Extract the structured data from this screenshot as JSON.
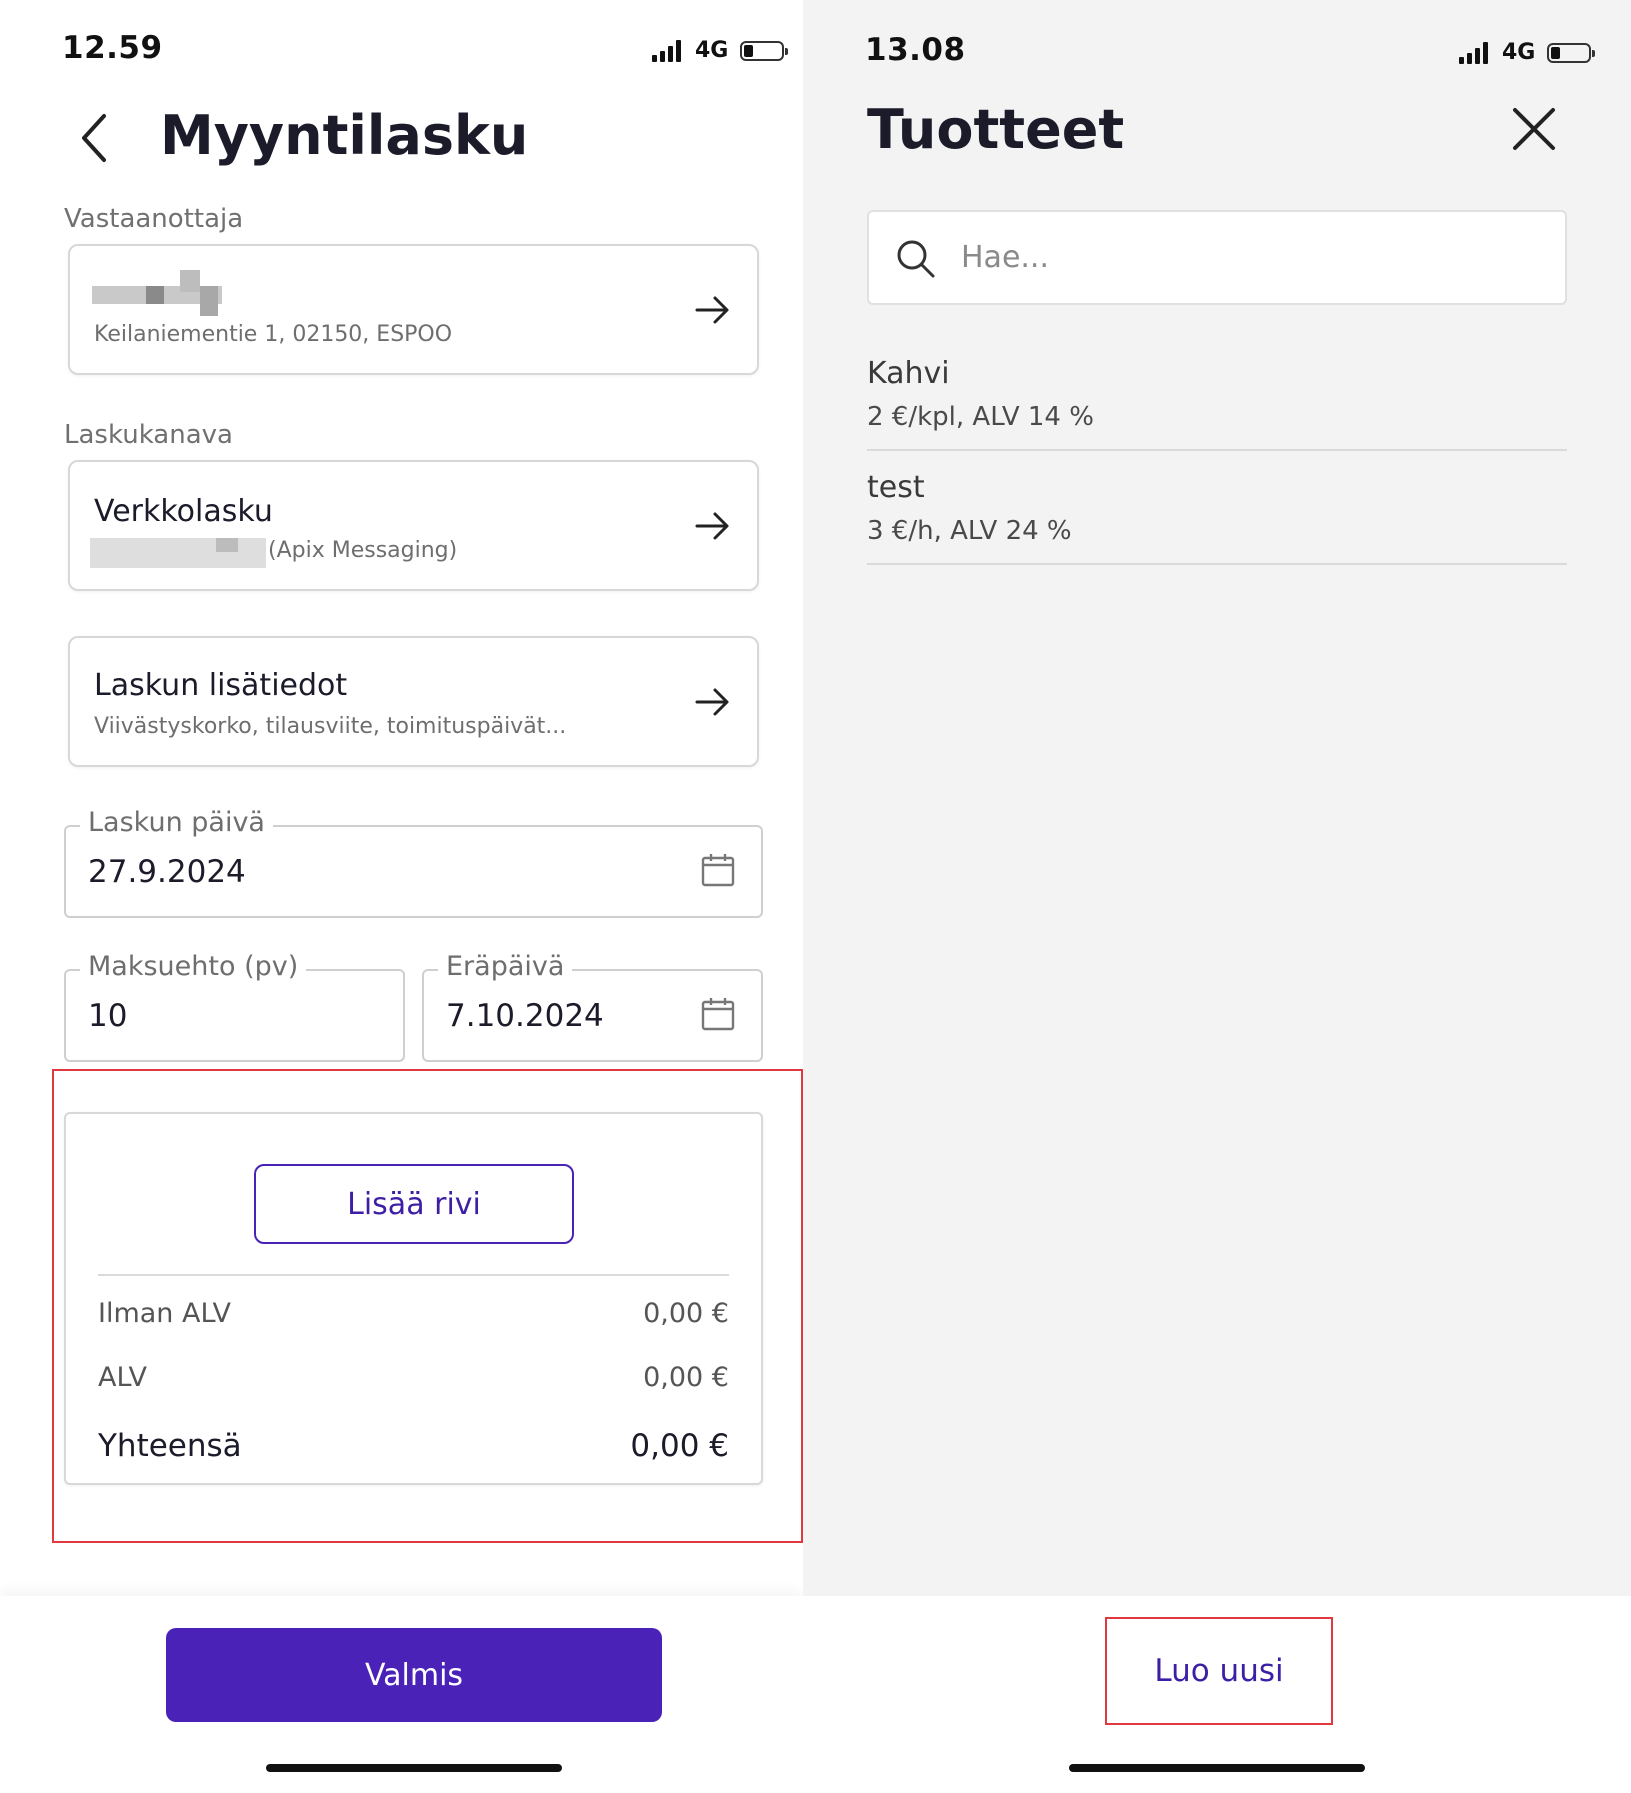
{
  "left": {
    "status": {
      "time": "12.59",
      "network": "4G",
      "battery_level": 0.2
    },
    "header": {
      "title": "Myyntilasku"
    },
    "recipient": {
      "section_label": "Vastaanottaja",
      "address": "Keilaniementie 1, 02150, ESPOO"
    },
    "channel": {
      "section_label": "Laskukanava",
      "title": "Verkkolasku",
      "subtitle": "(Apix Messaging)"
    },
    "extra_info": {
      "title": "Laskun lisätiedot",
      "subtitle": "Viivästyskorko, tilausviite, toimituspäivät..."
    },
    "invoice_date": {
      "label": "Laskun päivä",
      "value": "27.9.2024"
    },
    "payment_term": {
      "label": "Maksuehto (pv)",
      "value": "10"
    },
    "due_date": {
      "label": "Eräpäivä",
      "value": "7.10.2024"
    },
    "totals": {
      "add_row_label": "Lisää rivi",
      "rows": [
        {
          "label": "Ilman ALV",
          "value": "0,00 €"
        },
        {
          "label": "ALV",
          "value": "0,00 €"
        },
        {
          "label": "Yhteensä",
          "value": "0,00 €"
        }
      ]
    },
    "footer": {
      "done_label": "Valmis"
    }
  },
  "right": {
    "status": {
      "time": "13.08",
      "network": "4G",
      "battery_level": 0.2
    },
    "header": {
      "title": "Tuotteet"
    },
    "search": {
      "placeholder": "Hae..."
    },
    "products": [
      {
        "name": "Kahvi",
        "detail": "2 €/kpl, ALV 14 %"
      },
      {
        "name": "test",
        "detail": "3 €/h, ALV 24 %"
      }
    ],
    "footer": {
      "create_label": "Luo uusi"
    }
  },
  "colors": {
    "accent": "#4a22b8",
    "highlight": "#e0393e",
    "right_background": "#f3f3f3"
  }
}
